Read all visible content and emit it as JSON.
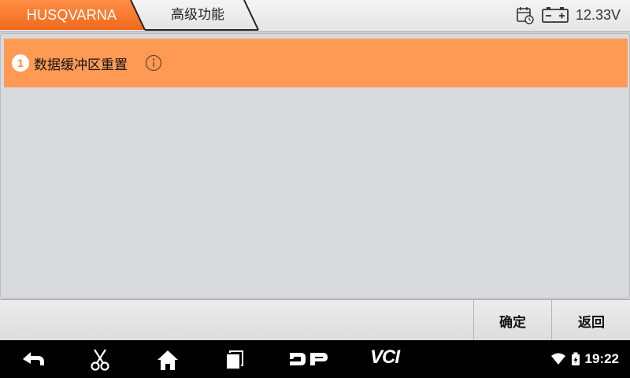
{
  "header": {
    "breadcrumbs": [
      {
        "label": "HUSQVARNA"
      },
      {
        "label": "高级功能"
      }
    ],
    "voltage": "12.33V",
    "icons": [
      "calendar-clock-icon",
      "battery-icon"
    ]
  },
  "functions": [
    {
      "number": "1",
      "label": "数据缓冲区重置",
      "icon": "info-icon"
    }
  ],
  "buttons": {
    "confirm": "确定",
    "back": "返回"
  },
  "navbar": {
    "icons": [
      "back-icon",
      "scissors-icon",
      "home-icon",
      "recent-apps-icon",
      "dp-icon",
      "vci-icon"
    ],
    "dp_label": "DP",
    "vci_label": "VCI",
    "time": "19:22"
  },
  "colors": {
    "accent": "#ff8a3c",
    "row_highlight": "#ff9a55",
    "background": "#d8dadd"
  }
}
